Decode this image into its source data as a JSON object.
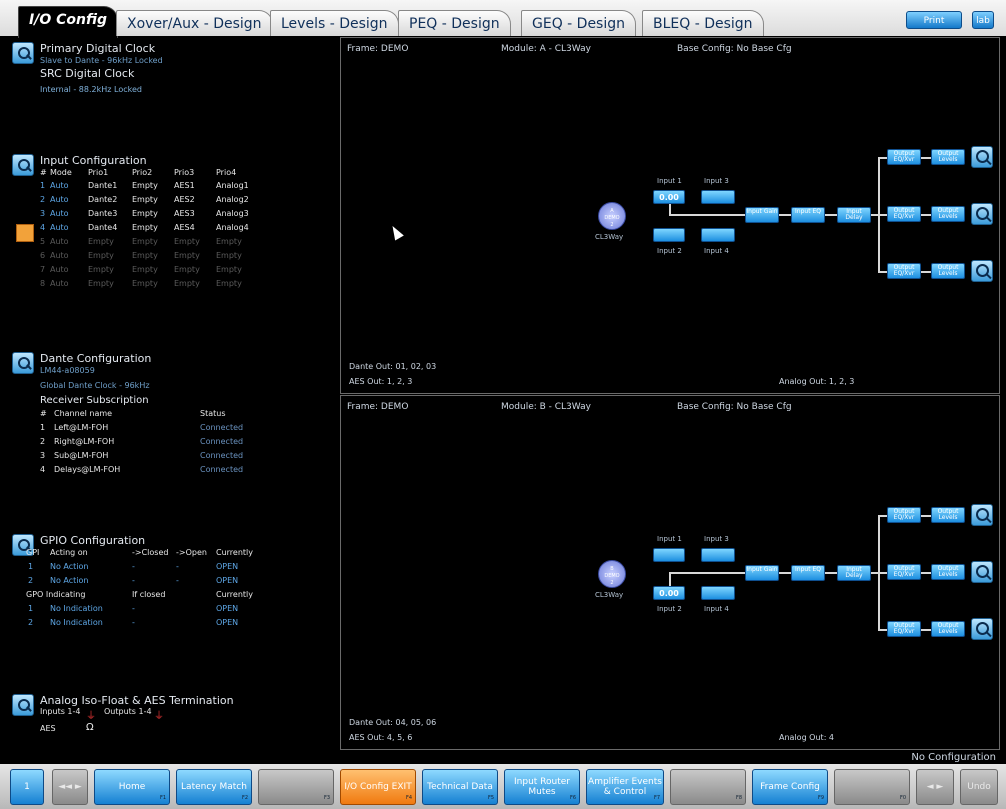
{
  "tabs": [
    {
      "label": "I/O Config",
      "active": true
    },
    {
      "label": "Xover/Aux - Design"
    },
    {
      "label": "Levels - Design"
    },
    {
      "label": "PEQ - Design"
    },
    {
      "label": "GEQ - Design"
    },
    {
      "label": "BLEQ - Design"
    }
  ],
  "top_buttons": {
    "print": "Print",
    "logo": "lab"
  },
  "clock": {
    "title": "Primary Digital Clock",
    "primary_status": "Slave to Dante - 96kHz Locked",
    "src_title": "SRC Digital Clock",
    "src_status": "Internal - 88.2kHz Locked"
  },
  "input_config": {
    "title": "Input Configuration",
    "headers": [
      "#",
      "Mode",
      "Prio1",
      "Prio2",
      "Prio3",
      "Prio4"
    ],
    "rows": [
      [
        "1",
        "Auto",
        "Dante1",
        "Empty",
        "AES1",
        "Analog1"
      ],
      [
        "2",
        "Auto",
        "Dante2",
        "Empty",
        "AES2",
        "Analog2"
      ],
      [
        "3",
        "Auto",
        "Dante3",
        "Empty",
        "AES3",
        "Analog3"
      ],
      [
        "4",
        "Auto",
        "Dante4",
        "Empty",
        "AES4",
        "Analog4"
      ],
      [
        "5",
        "Auto",
        "Empty",
        "Empty",
        "Empty",
        "Empty"
      ],
      [
        "6",
        "Auto",
        "Empty",
        "Empty",
        "Empty",
        "Empty"
      ],
      [
        "7",
        "Auto",
        "Empty",
        "Empty",
        "Empty",
        "Empty"
      ],
      [
        "8",
        "Auto",
        "Empty",
        "Empty",
        "Empty",
        "Empty"
      ]
    ]
  },
  "dante": {
    "title": "Dante Configuration",
    "device": "LM44-a08059",
    "clock": "Global Dante Clock - 96kHz",
    "subscription_title": "Receiver Subscription",
    "headers": [
      "#",
      "Channel name",
      "Status"
    ],
    "rows": [
      [
        "1",
        "Left@LM-FOH",
        "Connected"
      ],
      [
        "2",
        "Right@LM-FOH",
        "Connected"
      ],
      [
        "3",
        "Sub@LM-FOH",
        "Connected"
      ],
      [
        "4",
        "Delays@LM-FOH",
        "Connected"
      ]
    ]
  },
  "gpio": {
    "title": "GPIO Configuration",
    "gpi_headers": [
      "GPI",
      "Acting on",
      "->Closed",
      "->Open",
      "Currently"
    ],
    "gpi_rows": [
      [
        "1",
        "No Action",
        "-",
        "-",
        "OPEN"
      ],
      [
        "2",
        "No Action",
        "-",
        "-",
        "OPEN"
      ]
    ],
    "gpo_headers": [
      "GPO Indicating",
      "If closed",
      "Currently"
    ],
    "gpo_rows": [
      [
        "1",
        "No Indication",
        "-",
        "OPEN"
      ],
      [
        "2",
        "No Indication",
        "-",
        "OPEN"
      ]
    ]
  },
  "analog": {
    "title": "Analog Iso-Float & AES Termination",
    "inputs_label": "Inputs 1-4",
    "outputs_label": "Outputs 1-4",
    "aes_label": "AES",
    "aes_symbol": "Ω"
  },
  "module_a": {
    "frame": "Frame: DEMO",
    "module": "Module: A - CL3Way",
    "base": "Base Config: No Base Cfg",
    "circle": [
      "A",
      "DEMO",
      "2"
    ],
    "circle_caption": "CL3Way",
    "input1_label": "Input 1",
    "input3_label": "Input 3",
    "input2_label": "Input 2",
    "input4_label": "Input 4",
    "input1_value": "0.00",
    "dante_out": "Dante Out: 01, 02, 03",
    "aes_out": "AES Out: 1, 2, 3",
    "analog_out": "Analog Out: 1, 2, 3"
  },
  "module_b": {
    "frame": "Frame: DEMO",
    "module": "Module: B - CL3Way",
    "base": "Base Config: No Base Cfg",
    "circle": [
      "B",
      "DEMO",
      "2"
    ],
    "circle_caption": "CL3Way",
    "input1_label": "Input 1",
    "input3_label": "Input 3",
    "input2_label": "Input 2",
    "input4_label": "Input 4",
    "input2_value": "0.00",
    "dante_out": "Dante Out: 04, 05, 06",
    "aes_out": "AES Out: 4, 5, 6",
    "analog_out": "Analog Out: 4"
  },
  "chain": {
    "input_gain": "Input Gain",
    "input_eq": "Input EQ",
    "input_delay": "Input Delay",
    "output_eq": "Output EQ/Xvr",
    "output_levels": "Output Levels"
  },
  "status": "No Configuration",
  "bottom_buttons": [
    {
      "label": "1",
      "style": "blue",
      "key": ""
    },
    {
      "label": "◄◄ ►",
      "style": "grey",
      "key": ""
    },
    {
      "label": "Home",
      "style": "blue",
      "key": "F1"
    },
    {
      "label": "Latency Match",
      "style": "blue",
      "key": "F2"
    },
    {
      "label": "",
      "style": "grey",
      "key": "F3"
    },
    {
      "label": "I/O Config EXIT",
      "style": "orange",
      "key": "F4"
    },
    {
      "label": "Technical Data",
      "style": "blue",
      "key": "F5"
    },
    {
      "label": "Input Router Mutes",
      "style": "blue",
      "key": "F6"
    },
    {
      "label": "Amplifier Events & Control",
      "style": "blue",
      "key": "F7"
    },
    {
      "label": "",
      "style": "grey",
      "key": "F8"
    },
    {
      "label": "Frame Config",
      "style": "blue",
      "key": "F9"
    },
    {
      "label": "",
      "style": "grey",
      "key": "F0"
    },
    {
      "label": "◄ ►",
      "style": "grey",
      "key": ""
    },
    {
      "label": "Undo",
      "style": "grey",
      "key": ""
    }
  ]
}
